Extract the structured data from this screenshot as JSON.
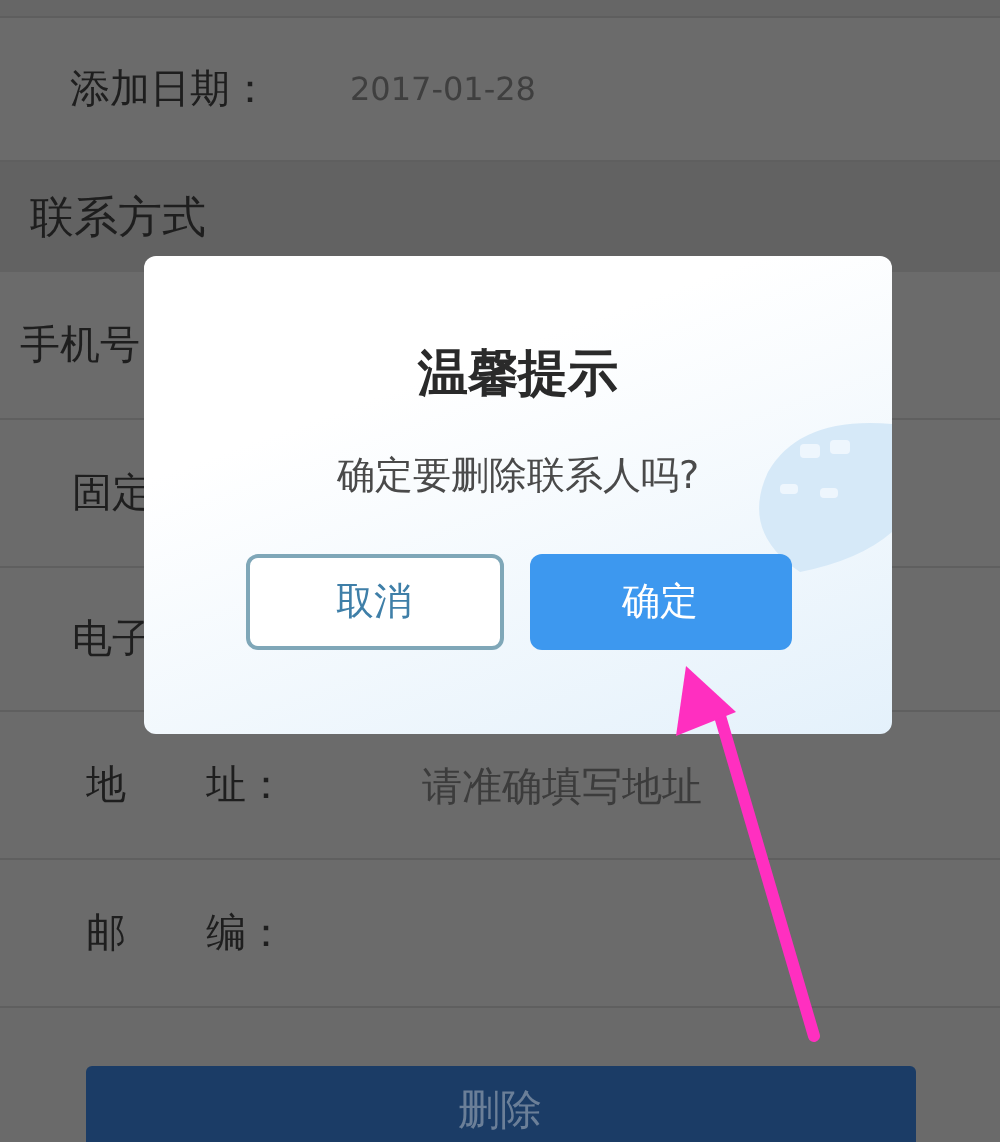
{
  "date_row": {
    "label": "添加日期：",
    "value": "2017-01-28"
  },
  "section": {
    "title": "联系方式"
  },
  "contact_rows": [
    {
      "label": "手机号"
    },
    {
      "label": "固定"
    },
    {
      "label": "电子"
    },
    {
      "label": "地　　址：",
      "placeholder": "请准确填写地址"
    },
    {
      "label": "邮　　编："
    }
  ],
  "delete_button": "删除",
  "dialog": {
    "title": "温馨提示",
    "message": "确定要删除联系人吗?",
    "buttons": [
      {
        "label": "取消",
        "kind": "secondary"
      },
      {
        "label": "确定",
        "kind": "primary"
      }
    ]
  }
}
